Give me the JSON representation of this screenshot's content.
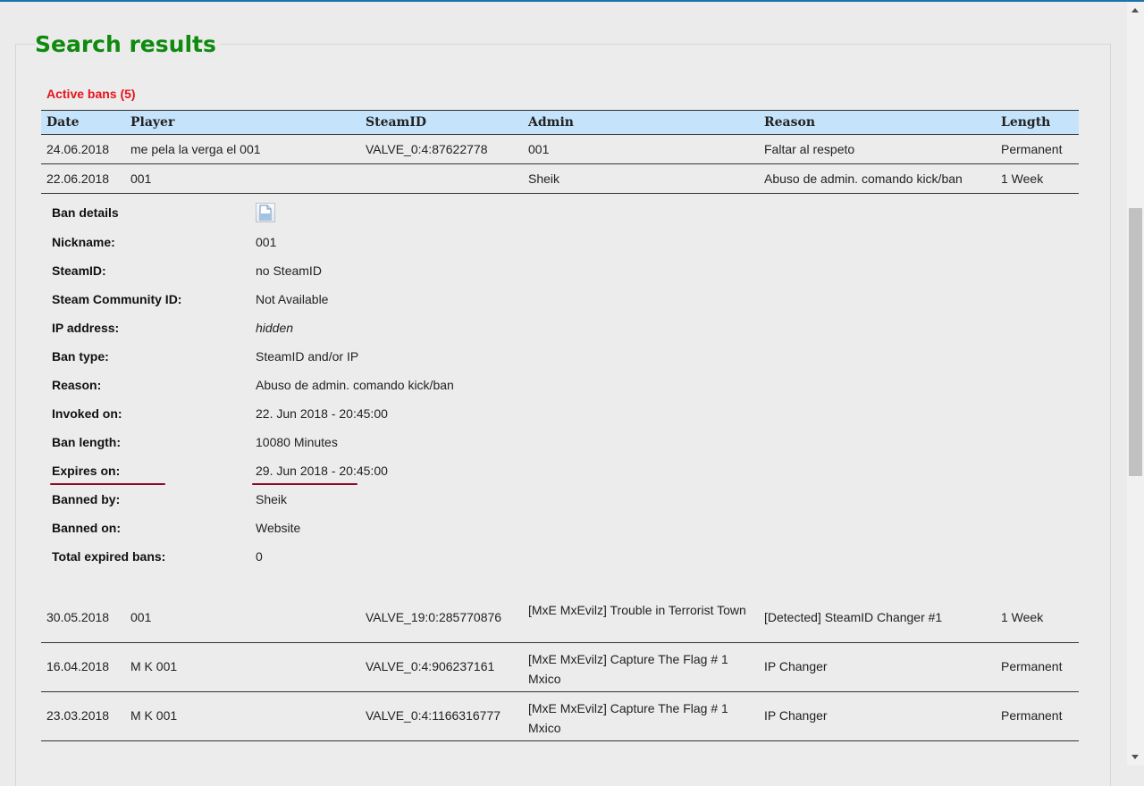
{
  "page": {
    "title": "Search results",
    "section_label": "Active bans (5)"
  },
  "table": {
    "headers": {
      "date": "Date",
      "player": "Player",
      "steamid": "SteamID",
      "admin": "Admin",
      "reason": "Reason",
      "length": "Length"
    },
    "rows": [
      {
        "date": "24.06.2018",
        "player": "me pela la verga el 001",
        "steamid": "VALVE_0:4:87622778",
        "admin": "001",
        "reason": "Faltar al respeto",
        "length": "Permanent"
      },
      {
        "date": "22.06.2018",
        "player": "001",
        "steamid": "",
        "admin": "Sheik",
        "reason": "Abuso de admin. comando kick/ban",
        "length": "1 Week"
      },
      {
        "date": "30.05.2018",
        "player": "001",
        "steamid": "VALVE_19:0:285770876",
        "admin": "[MxE MxEvilz] Trouble in Terrorist Town",
        "reason": "[Detected] SteamID Changer #1",
        "length": "1 Week"
      },
      {
        "date": "16.04.2018",
        "player": "M K 001",
        "steamid": "VALVE_0:4:906237161",
        "admin": "[MxE MxEvilz] Capture The Flag # 1 Mxico",
        "reason": "IP Changer",
        "length": "Permanent"
      },
      {
        "date": "23.03.2018",
        "player": "M K 001",
        "steamid": "VALVE_0:4:1166316777",
        "admin": "[MxE MxEvilz] Capture The Flag # 1 Mxico",
        "reason": "IP Changer",
        "length": "Permanent"
      }
    ]
  },
  "details": {
    "heading": "Ban details",
    "icon": "document-icon",
    "items": [
      {
        "label": "Nickname:",
        "value": "001"
      },
      {
        "label": "SteamID:",
        "value": "no SteamID"
      },
      {
        "label": "Steam Community ID:",
        "value": "Not Available"
      },
      {
        "label": "IP address:",
        "value": "hidden"
      },
      {
        "label": "Ban type:",
        "value": "SteamID and/or IP"
      },
      {
        "label": "Reason:",
        "value": "Abuso de admin. comando kick/ban"
      },
      {
        "label": "Invoked on:",
        "value": "22. Jun 2018 - 20:45:00"
      },
      {
        "label": "Ban length:",
        "value": "10080 Minutes"
      },
      {
        "label": "Expires on:",
        "value": "29. Jun 2018 - 20:45:00"
      },
      {
        "label": "Banned by:",
        "value": "Sheik"
      },
      {
        "label": "Banned on:",
        "value": "Website"
      },
      {
        "label": "Total expired bans:",
        "value": "0"
      }
    ]
  },
  "colors": {
    "title": "#0f8a0f",
    "section_label": "#e8131c",
    "header_bg": "#c5e3fb",
    "annotation": "#8b0a2a"
  }
}
